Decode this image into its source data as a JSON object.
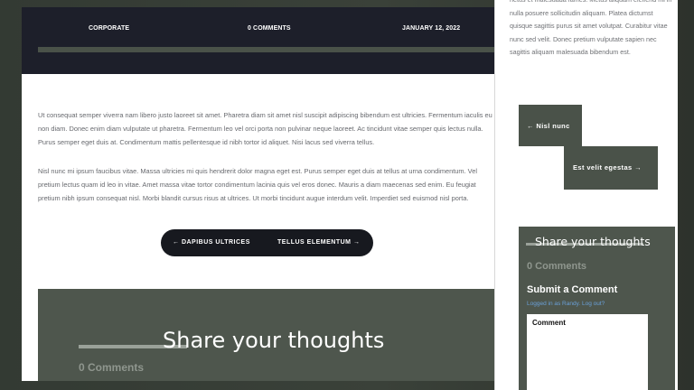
{
  "post_meta": {
    "category": "CORPORATE",
    "comments": "0 COMMENTS",
    "date": "JANUARY 12, 2022"
  },
  "body": {
    "paragraph1": "Ut consequat semper viverra nam libero justo laoreet sit amet. Pharetra diam sit amet nisl suscipit adipiscing bibendum est ultricies. Fermentum iaculis eu non diam. Donec enim diam vulputate ut pharetra. Fermentum leo vel orci porta non pulvinar neque laoreet. Ac tincidunt vitae semper quis lectus nulla. Purus semper eget duis at. Condimentum mattis pellentesque id nibh tortor id aliquet. Nisi lacus sed viverra tellus.",
    "paragraph2": "Nisl nunc mi ipsum faucibus vitae. Massa ultricies mi quis hendrerit dolor magna eget est. Purus semper eget duis at tellus at urna condimentum. Vel pretium lectus quam id leo in vitae. Amet massa vitae tortor condimentum lacinia quis vel eros donec. Mauris a diam maecenas sed enim. Eu feugiat pretium nibh ipsum consequat nisl. Morbi blandit cursus risus at ultrices. Ut morbi tincidunt augue interdum velit. Imperdiet sed euismod nisl porta."
  },
  "pagination": {
    "prev": "← DAPIBUS ULTRICES",
    "next": "TELLUS ELEMENTUM →"
  },
  "comments_section": {
    "title": "Share your thoughts",
    "count": "0 Comments"
  },
  "panel": {
    "text": "netus et malesuada fames. Metus aliquam eleifend mi in nulla posuere sollicitudin aliquam. Platea dictumst quisque sagittis purus sit amet volutpat. Curabitur vitae nunc sed velit. Donec pretium vulputate sapien nec sagittis aliquam malesuada bibendum est.",
    "prev": "← Nisl nunc",
    "next": "Est velit egestas →",
    "comments_title": "Share your thoughts",
    "comments_count": "0 Comments",
    "submit_title": "Submit a Comment",
    "logged_in": "Logged in as Randy.",
    "log_out": "Log out?",
    "comment_label": "Comment"
  },
  "colors": {
    "dark": "#1d1f2a",
    "accent": "#4e564d",
    "link": "#6aa0d8"
  }
}
